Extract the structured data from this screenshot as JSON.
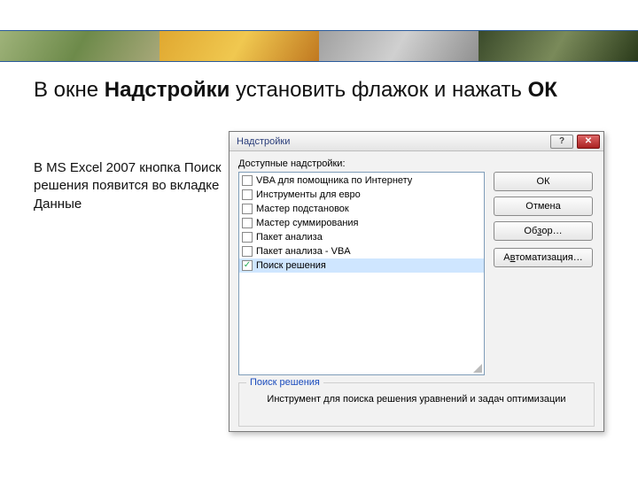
{
  "slide": {
    "title_pre": "В окне ",
    "title_bold1": "Надстройки",
    "title_mid": " установить флажок и нажать ",
    "title_bold2": "ОК",
    "subtitle": "В MS Excel 2007 кнопка Поиск решения появится во вкладке Данные"
  },
  "dialog": {
    "title": "Надстройки",
    "available_label_pre": "Д",
    "available_label_rest": "оступные надстройки:",
    "items": [
      {
        "label": "VBA для помощника по Интернету",
        "checked": false,
        "selected": false
      },
      {
        "label": "Инструменты для евро",
        "checked": false,
        "selected": false
      },
      {
        "label": "Мастер подстановок",
        "checked": false,
        "selected": false
      },
      {
        "label": "Мастер суммирования",
        "checked": false,
        "selected": false
      },
      {
        "label": "Пакет анализа",
        "checked": false,
        "selected": false
      },
      {
        "label": "Пакет анализа - VBA",
        "checked": false,
        "selected": false
      },
      {
        "label": "Поиск решения",
        "checked": true,
        "selected": true
      }
    ],
    "buttons": {
      "ok": "ОК",
      "cancel": "Отмена",
      "browse_pre": "Об",
      "browse_u": "з",
      "browse_post": "ор…",
      "auto_pre": "А",
      "auto_u": "в",
      "auto_post": "томатизация…"
    },
    "group": {
      "legend": "Поиск решения",
      "text": "Инструмент для поиска решения уравнений и задач оптимизации"
    }
  }
}
